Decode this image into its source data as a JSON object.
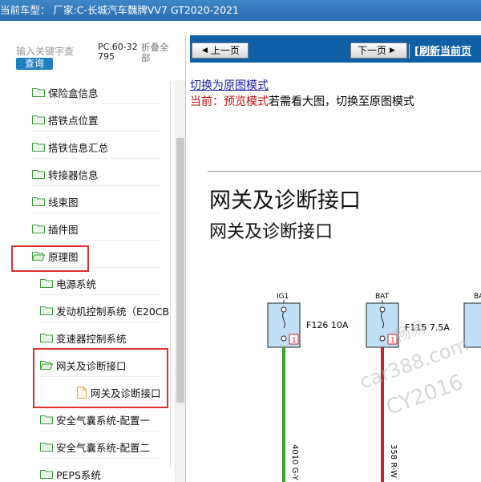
{
  "titlebar": {
    "text": "当前车型： 厂家:C-长城汽车魏牌VV7 GT2020-2021"
  },
  "left": {
    "search_placeholder": "输入关键字查",
    "search_button": "查询",
    "pc_code": "PC.60-32795",
    "collapse_all": "折叠全部",
    "tree": [
      {
        "label": "保险盒信息",
        "icon": "folder-closed-icon",
        "level": 1
      },
      {
        "label": "搭铁点位置",
        "icon": "folder-closed-icon",
        "level": 1
      },
      {
        "label": "搭铁信息汇总",
        "icon": "folder-closed-icon",
        "level": 1
      },
      {
        "label": "转接器信息",
        "icon": "folder-closed-icon",
        "level": 1
      },
      {
        "label": "线束图",
        "icon": "folder-closed-icon",
        "level": 1
      },
      {
        "label": "插件图",
        "icon": "folder-closed-icon",
        "level": 1
      },
      {
        "label": "原理图",
        "icon": "folder-open-icon",
        "level": 1
      },
      {
        "label": "电源系统",
        "icon": "folder-closed-icon",
        "level": 2
      },
      {
        "label": "发动机控制系统（E20CB",
        "icon": "folder-closed-icon",
        "level": 2
      },
      {
        "label": "变速器控制系统",
        "icon": "folder-closed-icon",
        "level": 2
      },
      {
        "label": "网关及诊断接口",
        "icon": "folder-open-icon",
        "level": 2
      },
      {
        "label": "网关及诊断接口",
        "icon": "document-icon",
        "level": 3
      },
      {
        "label": "安全气囊系统-配置一",
        "icon": "folder-closed-icon",
        "level": 2
      },
      {
        "label": "安全气囊系统-配置二",
        "icon": "folder-closed-icon",
        "level": 2
      },
      {
        "label": "PEPS系统",
        "icon": "folder-closed-icon",
        "level": 2
      }
    ]
  },
  "right": {
    "prev_button": "上一页",
    "next_button": "下一页",
    "refresh": "[刷新当前页",
    "switch_link": "切换为原图模式",
    "mode_prefix": "当前：预览模式",
    "mode_suffix": "若需看大图，切换至原图模式",
    "doc_title": "网关及诊断接口",
    "doc_subtitle": "网关及诊断接口",
    "fuses": [
      {
        "source": "IG1",
        "fuse": "F126 10A",
        "pin": "1",
        "wire": "4010 G-Y",
        "color": "#3aa02a"
      },
      {
        "source": "BAT",
        "fuse": "F115 7.5A",
        "pin": "1",
        "wire": "358 R-W",
        "color": "#c8202a"
      },
      {
        "source": "BA",
        "fuse": "",
        "pin": "",
        "wire": "",
        "color": ""
      }
    ],
    "watermark": [
      "畅易",
      "car388.com",
      "CY2016"
    ]
  },
  "colors": {
    "titlebar": "#2a6db0",
    "navbar": "#1060a8",
    "highlight_box": "#e03030",
    "button": "#1f7fbf"
  }
}
